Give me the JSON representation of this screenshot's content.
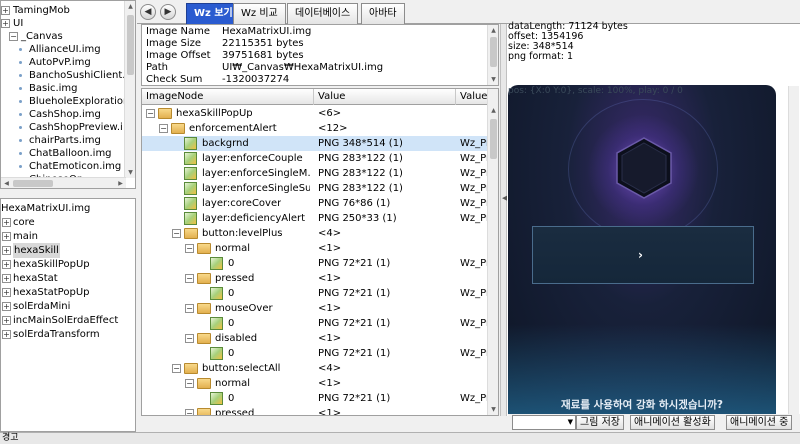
{
  "tree_top": {
    "rows": [
      {
        "label": "TamingMob",
        "indent": 0,
        "kind": "node"
      },
      {
        "label": "UI",
        "indent": 0,
        "kind": "node"
      },
      {
        "label": "_Canvas",
        "indent": 1,
        "kind": "folder-open"
      },
      {
        "label": "AllianceUI.img",
        "indent": 2,
        "kind": "file"
      },
      {
        "label": "AutoPvP.img",
        "indent": 2,
        "kind": "file"
      },
      {
        "label": "BanchoSushiClient.",
        "indent": 2,
        "kind": "file"
      },
      {
        "label": "Basic.img",
        "indent": 2,
        "kind": "file"
      },
      {
        "label": "BlueholeExploration",
        "indent": 2,
        "kind": "file"
      },
      {
        "label": "CashShop.img",
        "indent": 2,
        "kind": "file"
      },
      {
        "label": "CashShopPreview.i",
        "indent": 2,
        "kind": "file"
      },
      {
        "label": "chairParts.img",
        "indent": 2,
        "kind": "file"
      },
      {
        "label": "ChatBalloon.img",
        "indent": 2,
        "kind": "file"
      },
      {
        "label": "ChatEmoticon.img",
        "indent": 2,
        "kind": "file"
      },
      {
        "label": "ChineseOp",
        "indent": 2,
        "kind": "file"
      }
    ]
  },
  "tree_bottom": {
    "root": "HexaMatrixUI.img",
    "rows": [
      {
        "label": "core",
        "selected": false
      },
      {
        "label": "main",
        "selected": false
      },
      {
        "label": "hexaSkill",
        "selected": true
      },
      {
        "label": "hexaSkillPopUp",
        "selected": false
      },
      {
        "label": "hexaStat",
        "selected": false
      },
      {
        "label": "hexaStatPopUp",
        "selected": false
      },
      {
        "label": "solErdaMini",
        "selected": false
      },
      {
        "label": "incMainSolErdaEffect",
        "selected": false
      },
      {
        "label": "solErdaTransform",
        "selected": false
      }
    ]
  },
  "toolbar": {
    "back": "◀",
    "forward": "▶",
    "tabs": [
      {
        "label": "Wz 보기",
        "active": true
      },
      {
        "label": "Wz 비교",
        "active": false
      },
      {
        "label": "데이터베이스",
        "active": false
      },
      {
        "label": "아바타",
        "active": false
      }
    ]
  },
  "props": [
    {
      "key": "Image Name",
      "value": "HexaMatrixUI.img"
    },
    {
      "key": "Image Size",
      "value": "22115351 bytes"
    },
    {
      "key": "Image Offset",
      "value": "39751681 bytes"
    },
    {
      "key": "Path",
      "value": "UI₩_Canvas₩HexaMatrixUI.img"
    },
    {
      "key": "Check Sum",
      "value": "-1320037274"
    }
  ],
  "grid": {
    "headers": [
      "ImageNode",
      "Value",
      "Value"
    ],
    "rows": [
      {
        "name": "hexaSkillPopUp",
        "value": "<6>",
        "value2": "",
        "indent": 0,
        "icon": "folder",
        "exp": "-"
      },
      {
        "name": "enforcementAlert",
        "value": "<12>",
        "value2": "",
        "indent": 1,
        "icon": "folder",
        "exp": "-"
      },
      {
        "name": "backgrnd",
        "value": "PNG 348*514 (1)",
        "value2": "Wz_Pr",
        "indent": 2,
        "icon": "png",
        "exp": "",
        "selected": true
      },
      {
        "name": "layer:enforceCouple",
        "value": "PNG 283*122 (1)",
        "value2": "Wz_Pr",
        "indent": 2,
        "icon": "png",
        "exp": ""
      },
      {
        "name": "layer:enforceSingleM…",
        "value": "PNG 283*122 (1)",
        "value2": "Wz_Pr",
        "indent": 2,
        "icon": "png",
        "exp": ""
      },
      {
        "name": "layer:enforceSingleSub",
        "value": "PNG 283*122 (1)",
        "value2": "Wz_Pr",
        "indent": 2,
        "icon": "png",
        "exp": ""
      },
      {
        "name": "layer:coreCover",
        "value": "PNG 76*86 (1)",
        "value2": "Wz_Pr",
        "indent": 2,
        "icon": "png",
        "exp": ""
      },
      {
        "name": "layer:deficiencyAlert",
        "value": "PNG 250*33 (1)",
        "value2": "Wz_Pr",
        "indent": 2,
        "icon": "png",
        "exp": ""
      },
      {
        "name": "button:levelPlus",
        "value": "<4>",
        "value2": "",
        "indent": 2,
        "icon": "folder",
        "exp": "-"
      },
      {
        "name": "normal",
        "value": "<1>",
        "value2": "",
        "indent": 3,
        "icon": "folder",
        "exp": "-"
      },
      {
        "name": "0",
        "value": "PNG 72*21 (1)",
        "value2": "Wz_Pr",
        "indent": 4,
        "icon": "png",
        "exp": ""
      },
      {
        "name": "pressed",
        "value": "<1>",
        "value2": "",
        "indent": 3,
        "icon": "folder",
        "exp": "-"
      },
      {
        "name": "0",
        "value": "PNG 72*21 (1)",
        "value2": "Wz_Pr",
        "indent": 4,
        "icon": "png",
        "exp": ""
      },
      {
        "name": "mouseOver",
        "value": "<1>",
        "value2": "",
        "indent": 3,
        "icon": "folder",
        "exp": "-"
      },
      {
        "name": "0",
        "value": "PNG 72*21 (1)",
        "value2": "Wz_Pr",
        "indent": 4,
        "icon": "png",
        "exp": ""
      },
      {
        "name": "disabled",
        "value": "<1>",
        "value2": "",
        "indent": 3,
        "icon": "folder",
        "exp": "-"
      },
      {
        "name": "0",
        "value": "PNG 72*21 (1)",
        "value2": "Wz_Pr",
        "indent": 4,
        "icon": "png",
        "exp": ""
      },
      {
        "name": "button:selectAll",
        "value": "<4>",
        "value2": "",
        "indent": 2,
        "icon": "folder",
        "exp": "-"
      },
      {
        "name": "normal",
        "value": "<1>",
        "value2": "",
        "indent": 3,
        "icon": "folder",
        "exp": "-"
      },
      {
        "name": "0",
        "value": "PNG 72*21 (1)",
        "value2": "Wz_Pr",
        "indent": 4,
        "icon": "png",
        "exp": ""
      },
      {
        "name": "pressed",
        "value": "<1>",
        "value2": "",
        "indent": 3,
        "icon": "folder",
        "exp": "-"
      }
    ]
  },
  "preview": {
    "info": [
      "dataLength: 71124 bytes",
      "offset: 1354196",
      "size: 348*514",
      "png format: 1"
    ],
    "pos_text": "pos: {X:0 Y:0}, scale: 100%, play: 0 / 0",
    "prompt": "재료를 사용하여 강화 하시겠습니까?"
  },
  "bottom_bar": {
    "combo_arrow": "▼",
    "buttons": [
      "그림 저장",
      "애니메이션 활성화",
      "애니메이션 중"
    ]
  },
  "status": {
    "text": "경고"
  }
}
